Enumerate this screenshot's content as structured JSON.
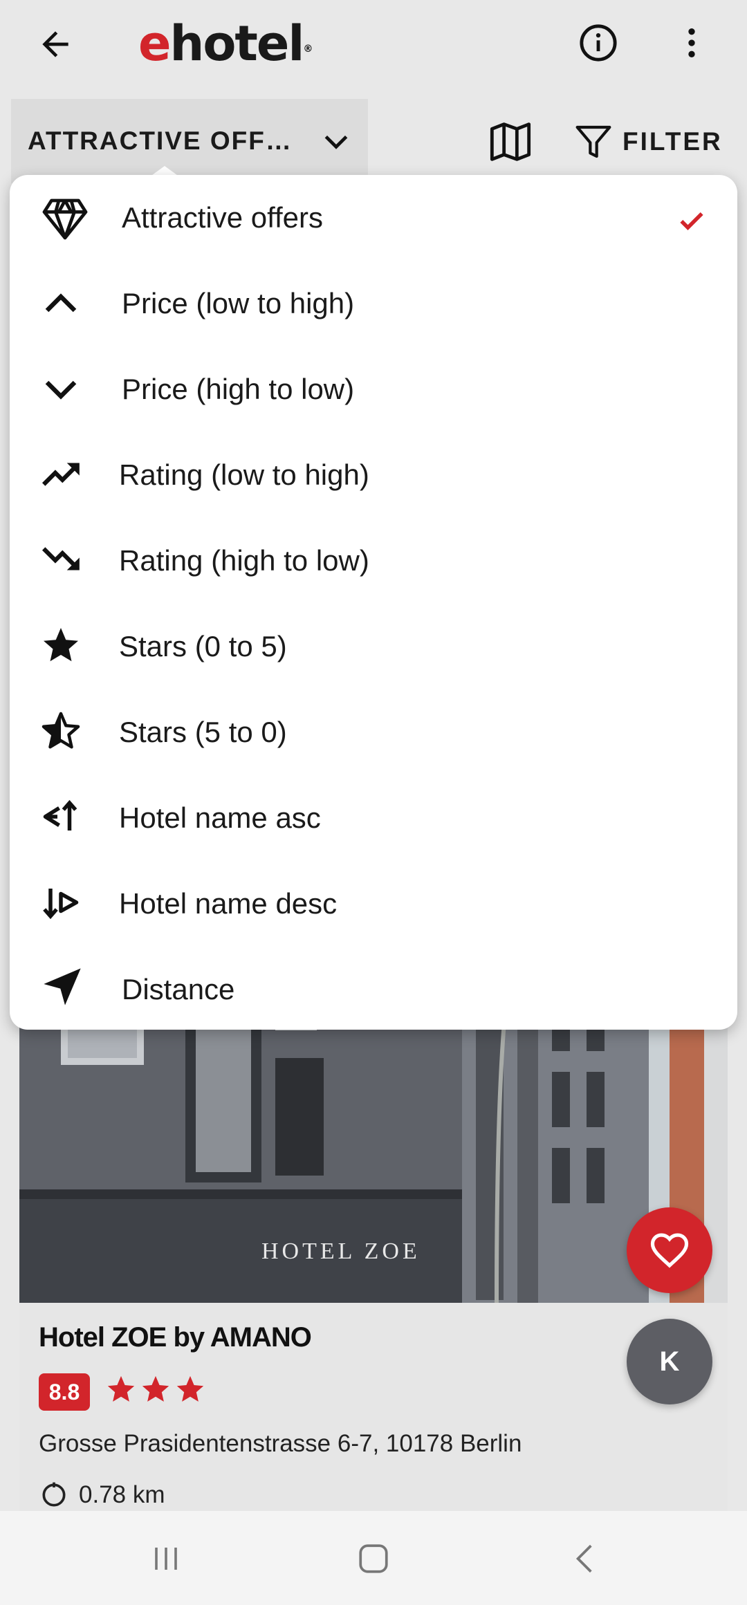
{
  "app": {
    "logo_e": "e",
    "logo_rest": "hotel",
    "logo_reg": "®"
  },
  "toolbar": {
    "sort_label": "ATTRACTIVE OFF…",
    "filter_label": "FILTER"
  },
  "sort_menu": {
    "items": [
      {
        "label": "Attractive offers",
        "icon": "diamond-icon",
        "selected": true
      },
      {
        "label": "Price (low to high)",
        "icon": "chevron-up-icon",
        "selected": false
      },
      {
        "label": "Price (high to low)",
        "icon": "chevron-down-icon",
        "selected": false
      },
      {
        "label": "Rating (low to high)",
        "icon": "trending-up-icon",
        "selected": false
      },
      {
        "label": "Rating (high to low)",
        "icon": "trending-down-icon",
        "selected": false
      },
      {
        "label": "Stars (0 to 5)",
        "icon": "star-icon",
        "selected": false
      },
      {
        "label": "Stars (5 to 0)",
        "icon": "half-star-icon",
        "selected": false
      },
      {
        "label": "Hotel name asc",
        "icon": "sort-name-asc-icon",
        "selected": false
      },
      {
        "label": "Hotel name desc",
        "icon": "sort-name-desc-icon",
        "selected": false
      },
      {
        "label": "Distance",
        "icon": "navigation-icon",
        "selected": false
      }
    ]
  },
  "hotel_card": {
    "photo_sign": "HOTEL ZOE",
    "name": "Hotel ZOE by AMANO",
    "rating": "8.8",
    "stars": 3,
    "address": "Grosse Prasidentenstrasse 6-7, 10178 Berlin",
    "distance": "0.78 km"
  },
  "fab": {
    "profile_initial": "K"
  },
  "colors": {
    "brand_red": "#d2252b",
    "fab_gray": "#5d5e64"
  }
}
